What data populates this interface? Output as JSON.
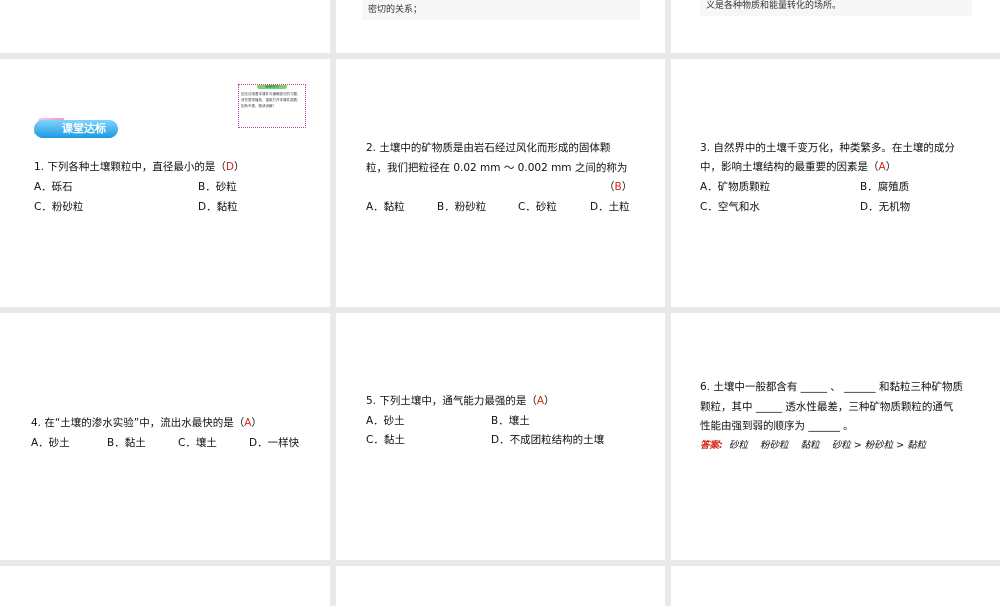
{
  "slides": [
    {
      "id": "top2",
      "text": "密切的关系；"
    },
    {
      "id": "top3",
      "text": "义是各种物质和能量转化的场所。"
    }
  ],
  "s1": {
    "badge": "课堂达标",
    "tip_title": "温馨提示",
    "tip_text": "如无法观看本课件可编辑部分的习题，请先暂停播放，重新打开本课件观看，如有不便，敬请谅解！",
    "q": "1. 下列各种土壤颗粒中，直径最小的是（",
    "ans": "D",
    "close": "）",
    "a": "A．砾石",
    "b": "B．砂粒",
    "c": "C．粉砂粒",
    "d": "D．黏粒"
  },
  "s2": {
    "q1": "2. 土壤中的矿物质是由岩石经过风化而形成的固体颗",
    "q2": "粒，我们把粒径在 0.02 mm ～ 0.002 mm 之间的称为",
    "open": "（",
    "ans": "B",
    "close": "）",
    "a": "A．黏粒",
    "b": "B．粉砂粒",
    "c": "C．砂粒",
    "d": "D．土粒"
  },
  "s3": {
    "q1": "3. 自然界中的土壤千变万化，种类繁多。在土壤的成分",
    "q2": "中，影响土壤结构的最重要的因素是（",
    "ans": "A",
    "close": "）",
    "a": "A．矿物质颗粒",
    "b": "B．腐殖质",
    "c": "C．空气和水",
    "d": "D．无机物"
  },
  "s4": {
    "q": "4. 在“土壤的渗水实验”中，流出水最快的是（",
    "ans": "A",
    "close": "）",
    "a": "A．砂土",
    "b": "B．黏土",
    "c": "C．壤土",
    "d": "D．一样快"
  },
  "s5": {
    "q": "5. 下列土壤中，通气能力最强的是（",
    "ans": "A",
    "close": "）",
    "a": "A．砂土",
    "b": "B．壤土",
    "c": "C．黏土",
    "d": "D．不成团粒结构的土壤"
  },
  "s6": {
    "l1": "6. 土壤中一般都含有 _____ 、 ______ 和黏粒三种矿物质",
    "l2": "颗粒，其中 _____ 透水性最差，三种矿物质颗粒的通气",
    "l3": "性能由强到弱的顺序为 ______ 。",
    "ans_label": "答案:",
    "a1": "砂粒",
    "a2": "粉砂粒",
    "a3": "黏粒",
    "a4": "砂粒 > 粉砂粒 > 黏粒"
  }
}
